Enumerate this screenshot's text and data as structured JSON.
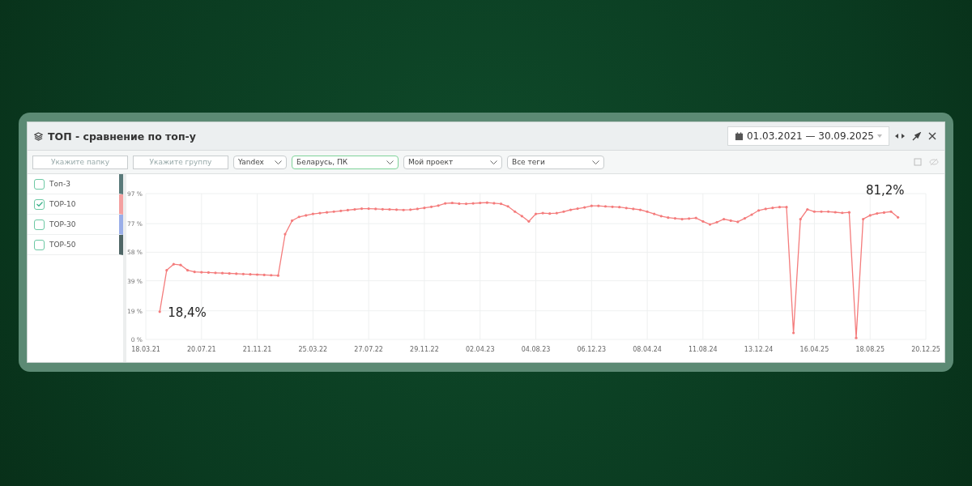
{
  "window": {
    "title": "ТОП - сравнение по топ-у",
    "date_range": "01.03.2021 — 30.09.2025"
  },
  "filters": [
    {
      "kind": "input",
      "placeholder": "Укажите папку"
    },
    {
      "kind": "input",
      "placeholder": "Укажите группу"
    },
    {
      "kind": "select",
      "value": "Yandex",
      "selected": false
    },
    {
      "kind": "select",
      "value": "Беларусь, ПК",
      "selected": true
    },
    {
      "kind": "select",
      "value": "Мой проект",
      "selected": false
    },
    {
      "kind": "select",
      "value": "Все теги",
      "selected": false
    }
  ],
  "legend": [
    {
      "label": "Топ-3",
      "checked": false,
      "color": "#5a7a7a"
    },
    {
      "label": "TOP-10",
      "checked": true,
      "color": "#f4a0a0"
    },
    {
      "label": "TOP-30",
      "checked": false,
      "color": "#9aaee8"
    },
    {
      "label": "TOP-50",
      "checked": false,
      "color": "#4f6666"
    }
  ],
  "chart_data": {
    "type": "line",
    "categories": [
      "18.03.21",
      null,
      null,
      null,
      null,
      null,
      null,
      null,
      "20.07.21",
      null,
      null,
      null,
      null,
      null,
      null,
      null,
      "21.11.21",
      null,
      null,
      null,
      null,
      null,
      null,
      null,
      "25.03.22",
      null,
      null,
      null,
      null,
      null,
      null,
      null,
      "27.07.22",
      null,
      null,
      null,
      null,
      null,
      null,
      null,
      "29.11.22",
      null,
      null,
      null,
      null,
      null,
      null,
      null,
      "02.04.23",
      null,
      null,
      null,
      null,
      null,
      null,
      null,
      "04.08.23",
      null,
      null,
      null,
      null,
      null,
      null,
      null,
      "06.12.23",
      null,
      null,
      null,
      null,
      null,
      null,
      null,
      "08.04.24",
      null,
      null,
      null,
      null,
      null,
      null,
      null,
      "11.08.24",
      null,
      null,
      null,
      null,
      null,
      null,
      null,
      "13.12.24",
      null,
      null,
      null,
      null,
      null,
      null,
      null,
      "16.04.25",
      null,
      null,
      null,
      null,
      null,
      null,
      null,
      "18.08.25",
      null,
      null,
      null,
      null,
      null,
      null,
      null,
      "20.12.25"
    ],
    "series": [
      {
        "color": "#f47c7c",
        "values": [
          null,
          null,
          18.4,
          46,
          50,
          49.5,
          46,
          44.9,
          44.7,
          44.5,
          44.3,
          44.1,
          43.9,
          43.7,
          43.5,
          43.3,
          43.1,
          42.9,
          42.7,
          42.5,
          70,
          79,
          81.5,
          82.5,
          83.5,
          84,
          84.5,
          85,
          85.5,
          86,
          86.5,
          87,
          87,
          86.8,
          86.6,
          86.5,
          86.3,
          86.1,
          86.3,
          86.8,
          87.5,
          88.2,
          89,
          90.5,
          90.8,
          90.3,
          90.2,
          90.5,
          90.8,
          91,
          90.6,
          90.2,
          88.5,
          85,
          82,
          78.5,
          83.5,
          84,
          83.7,
          84,
          85,
          86.2,
          87,
          87.8,
          88.8,
          88.8,
          88.5,
          88.2,
          88,
          87.4,
          86.8,
          86.2,
          85,
          83.5,
          82,
          81,
          80.5,
          80,
          80.4,
          80.8,
          78.5,
          76.5,
          78,
          80,
          79,
          78.2,
          80.5,
          83,
          85.8,
          86.8,
          87.5,
          88,
          88,
          4.3,
          80,
          86.5,
          85,
          85,
          85,
          84.6,
          84.2,
          84.5,
          1,
          80,
          82.5,
          83.8,
          84.4,
          85,
          81.2,
          null,
          null,
          null,
          null
        ]
      }
    ],
    "ylim": [
      0,
      97
    ],
    "yticks": [
      {
        "value": 0,
        "label": "0 %"
      },
      {
        "value": 19,
        "label": "19 %"
      },
      {
        "value": 39,
        "label": "39 %"
      },
      {
        "value": 58,
        "label": "58 %"
      },
      {
        "value": 77,
        "label": "77 %"
      },
      {
        "value": 97,
        "label": "97 %"
      }
    ],
    "grid": true,
    "annotations": [
      "18,4%",
      "81,2%"
    ]
  }
}
